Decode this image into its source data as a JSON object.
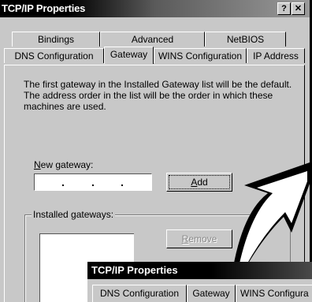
{
  "window": {
    "title": "TCP/IP Properties",
    "help_label": "?",
    "close_label": "✕"
  },
  "tabs_back": [
    "Bindings",
    "Advanced",
    "NetBIOS"
  ],
  "tabs_front": [
    "DNS Configuration",
    "Gateway",
    "WINS Configuration",
    "IP Address"
  ],
  "active_tab": "Gateway",
  "description": "The first gateway in the Installed Gateway list will be the default. The address order in the list will be the order in which these machines are used.",
  "new_gateway": {
    "label_prefix": "N",
    "label_rest": "ew gateway:",
    "value": ""
  },
  "add_button": {
    "prefix": "",
    "accel": "A",
    "rest": "dd"
  },
  "installed_gateways": {
    "label": "Installed gateways:",
    "items": []
  },
  "remove_button": {
    "accel": "R",
    "rest": "emove"
  },
  "second_window": {
    "title": "TCP/IP Properties",
    "tabs": [
      "DNS Configuration",
      "Gateway",
      "WINS Configura"
    ]
  },
  "colors": {
    "face": "#c8c8c8",
    "titlebar": "#000000",
    "disabled_text": "#8a8a8a"
  }
}
